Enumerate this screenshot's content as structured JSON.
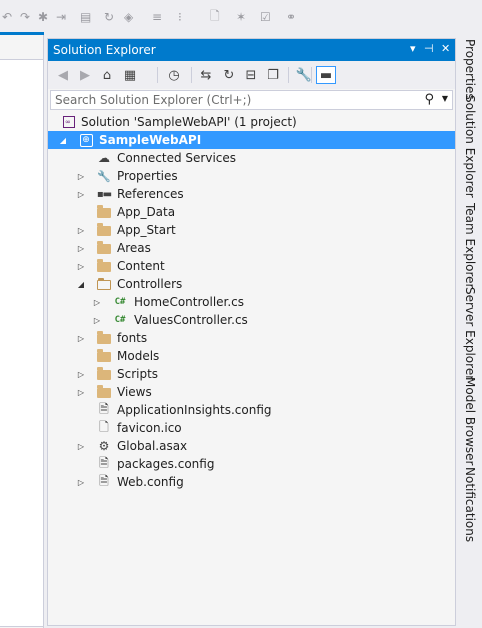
{
  "toolbar": {
    "buttons": [
      {
        "name": "undo-icon",
        "glyph": "↶"
      },
      {
        "name": "redo-icon",
        "glyph": "↷"
      },
      {
        "name": "debug-icon",
        "glyph": "✱"
      },
      {
        "name": "step-over-icon",
        "glyph": "⇥"
      },
      {
        "name": "step-into-icon",
        "glyph": "▤"
      },
      {
        "name": "restart-icon",
        "glyph": "↻"
      },
      {
        "name": "stop-icon",
        "glyph": "◈"
      },
      {
        "name": "align-icon",
        "glyph": "≡"
      },
      {
        "name": "comment-icon",
        "glyph": "⁝"
      },
      {
        "name": "bookmark-icon",
        "glyph": "🗋"
      },
      {
        "name": "new-item-icon",
        "glyph": "✶"
      },
      {
        "name": "save-all-icon",
        "glyph": "☑"
      },
      {
        "name": "link-icon",
        "glyph": "⚭"
      }
    ]
  },
  "panel": {
    "title": "Solution Explorer",
    "controls": {
      "dropdown": "▾",
      "pin": "⊣",
      "close": "✕"
    },
    "tools": [
      {
        "name": "back-icon",
        "glyph": "◀",
        "dim": true
      },
      {
        "name": "forward-icon",
        "glyph": "▶",
        "dim": true
      },
      {
        "name": "home-icon",
        "glyph": "⌂"
      },
      {
        "name": "switch-views-icon",
        "glyph": "▦"
      },
      {
        "name": "pending-changes-icon",
        "glyph": "◷"
      },
      {
        "name": "sync-icon",
        "glyph": "⇆"
      },
      {
        "name": "refresh-icon",
        "glyph": "↻"
      },
      {
        "name": "collapse-all-icon",
        "glyph": "⊟"
      },
      {
        "name": "show-all-files-icon",
        "glyph": "❐"
      },
      {
        "name": "properties-wrench-icon",
        "glyph": "🔧"
      },
      {
        "name": "preview-icon",
        "glyph": "▬"
      }
    ],
    "search": {
      "placeholder": "Search Solution Explorer (Ctrl+;)"
    }
  },
  "tree": [
    {
      "label": "Solution 'SampleWebAPI' (1 project)",
      "level": 0,
      "icon": "solution",
      "expand": ""
    },
    {
      "label": "SampleWebAPI",
      "level": 0,
      "icon": "project",
      "expand": "open",
      "selected": true
    },
    {
      "label": "Connected Services",
      "level": 1,
      "icon": "connected",
      "expand": ""
    },
    {
      "label": "Properties",
      "level": 1,
      "icon": "wrench",
      "expand": "closed"
    },
    {
      "label": "References",
      "level": 1,
      "icon": "references",
      "expand": "closed"
    },
    {
      "label": "App_Data",
      "level": 1,
      "icon": "folder",
      "expand": ""
    },
    {
      "label": "App_Start",
      "level": 1,
      "icon": "folder",
      "expand": "closed"
    },
    {
      "label": "Areas",
      "level": 1,
      "icon": "folder",
      "expand": "closed"
    },
    {
      "label": "Content",
      "level": 1,
      "icon": "folder",
      "expand": "closed"
    },
    {
      "label": "Controllers",
      "level": 1,
      "icon": "folder-open",
      "expand": "open"
    },
    {
      "label": "HomeController.cs",
      "level": 2,
      "icon": "cs",
      "expand": "closed"
    },
    {
      "label": "ValuesController.cs",
      "level": 2,
      "icon": "cs",
      "expand": "closed"
    },
    {
      "label": "fonts",
      "level": 1,
      "icon": "folder",
      "expand": "closed"
    },
    {
      "label": "Models",
      "level": 1,
      "icon": "folder",
      "expand": ""
    },
    {
      "label": "Scripts",
      "level": 1,
      "icon": "folder",
      "expand": "closed"
    },
    {
      "label": "Views",
      "level": 1,
      "icon": "folder",
      "expand": "closed"
    },
    {
      "label": "ApplicationInsights.config",
      "level": 1,
      "icon": "config",
      "expand": ""
    },
    {
      "label": "favicon.ico",
      "level": 1,
      "icon": "file",
      "expand": ""
    },
    {
      "label": "Global.asax",
      "level": 1,
      "icon": "asax",
      "expand": "closed"
    },
    {
      "label": "packages.config",
      "level": 1,
      "icon": "config",
      "expand": ""
    },
    {
      "label": "Web.config",
      "level": 1,
      "icon": "config",
      "expand": "closed"
    }
  ],
  "dock_tabs": [
    "Properties",
    "Solution Explorer",
    "Team Explorer",
    "Server Explorer",
    "Model Browser",
    "Notifications"
  ],
  "colors": {
    "accent": "#007acc",
    "selection": "#3399ff",
    "folder": "#dcb67a",
    "csharp": "#388a34"
  }
}
